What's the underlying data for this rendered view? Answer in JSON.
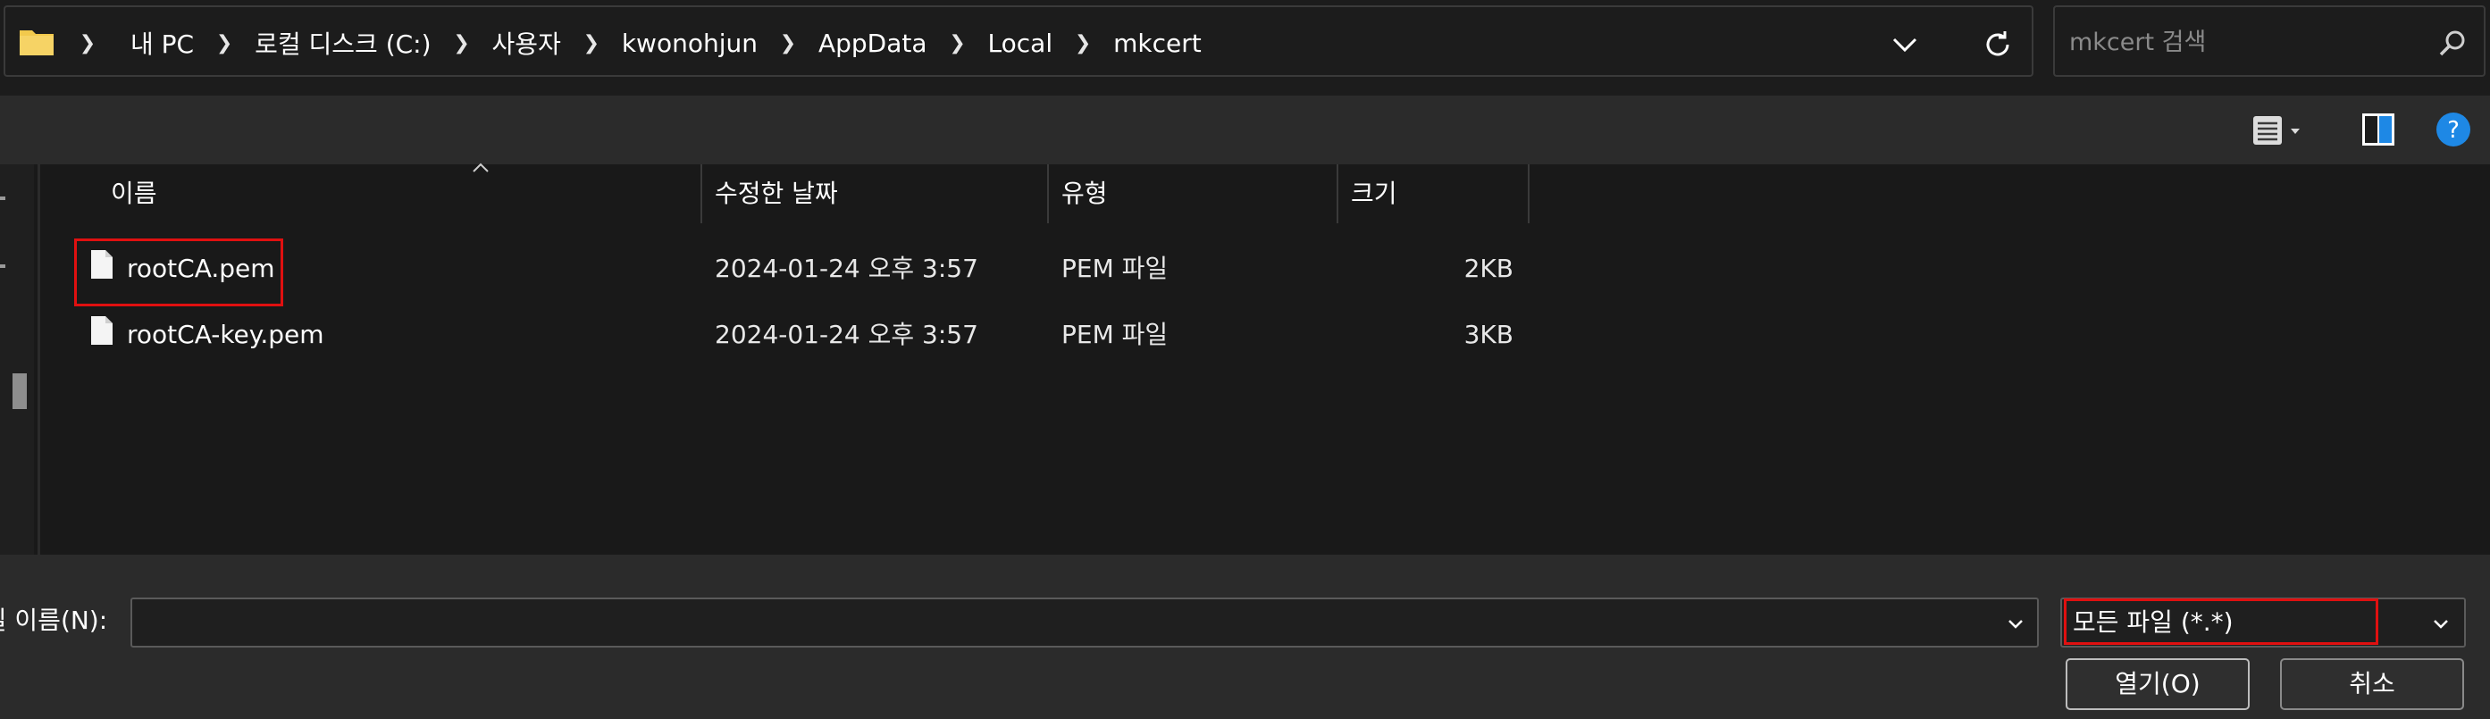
{
  "address_bar": {
    "crumbs": [
      "내 PC",
      "로컬 디스크 (C:)",
      "사용자",
      "kwonohjun",
      "AppData",
      "Local",
      "mkcert"
    ]
  },
  "search": {
    "placeholder": "mkcert 검색"
  },
  "columns": {
    "name": "이름",
    "modified": "수정한 날짜",
    "type": "유형",
    "size": "크기"
  },
  "files": [
    {
      "name": "rootCA.pem",
      "modified": "2024-01-24 오후 3:57",
      "type": "PEM 파일",
      "size": "2KB",
      "highlighted": true
    },
    {
      "name": "rootCA-key.pem",
      "modified": "2024-01-24 오후 3:57",
      "type": "PEM 파일",
      "size": "3KB",
      "highlighted": false
    }
  ],
  "footer": {
    "filename_label": "파일 이름(N):",
    "filename_value": "",
    "filetype_value": "모든 파일 (*.*)",
    "open_label": "열기(O)",
    "cancel_label": "취소"
  },
  "colors": {
    "background": "#191919",
    "toolbar": "#2b2b2b",
    "highlight": "#e01010",
    "help_accent": "#1e88e5",
    "folder": "#f2c94c"
  },
  "icons": [
    "folder-icon",
    "chevron-right-icon",
    "chevron-down-icon",
    "refresh-icon",
    "search-icon",
    "view-list-icon",
    "preview-pane-icon",
    "help-icon",
    "sort-up-icon",
    "file-icon"
  ]
}
